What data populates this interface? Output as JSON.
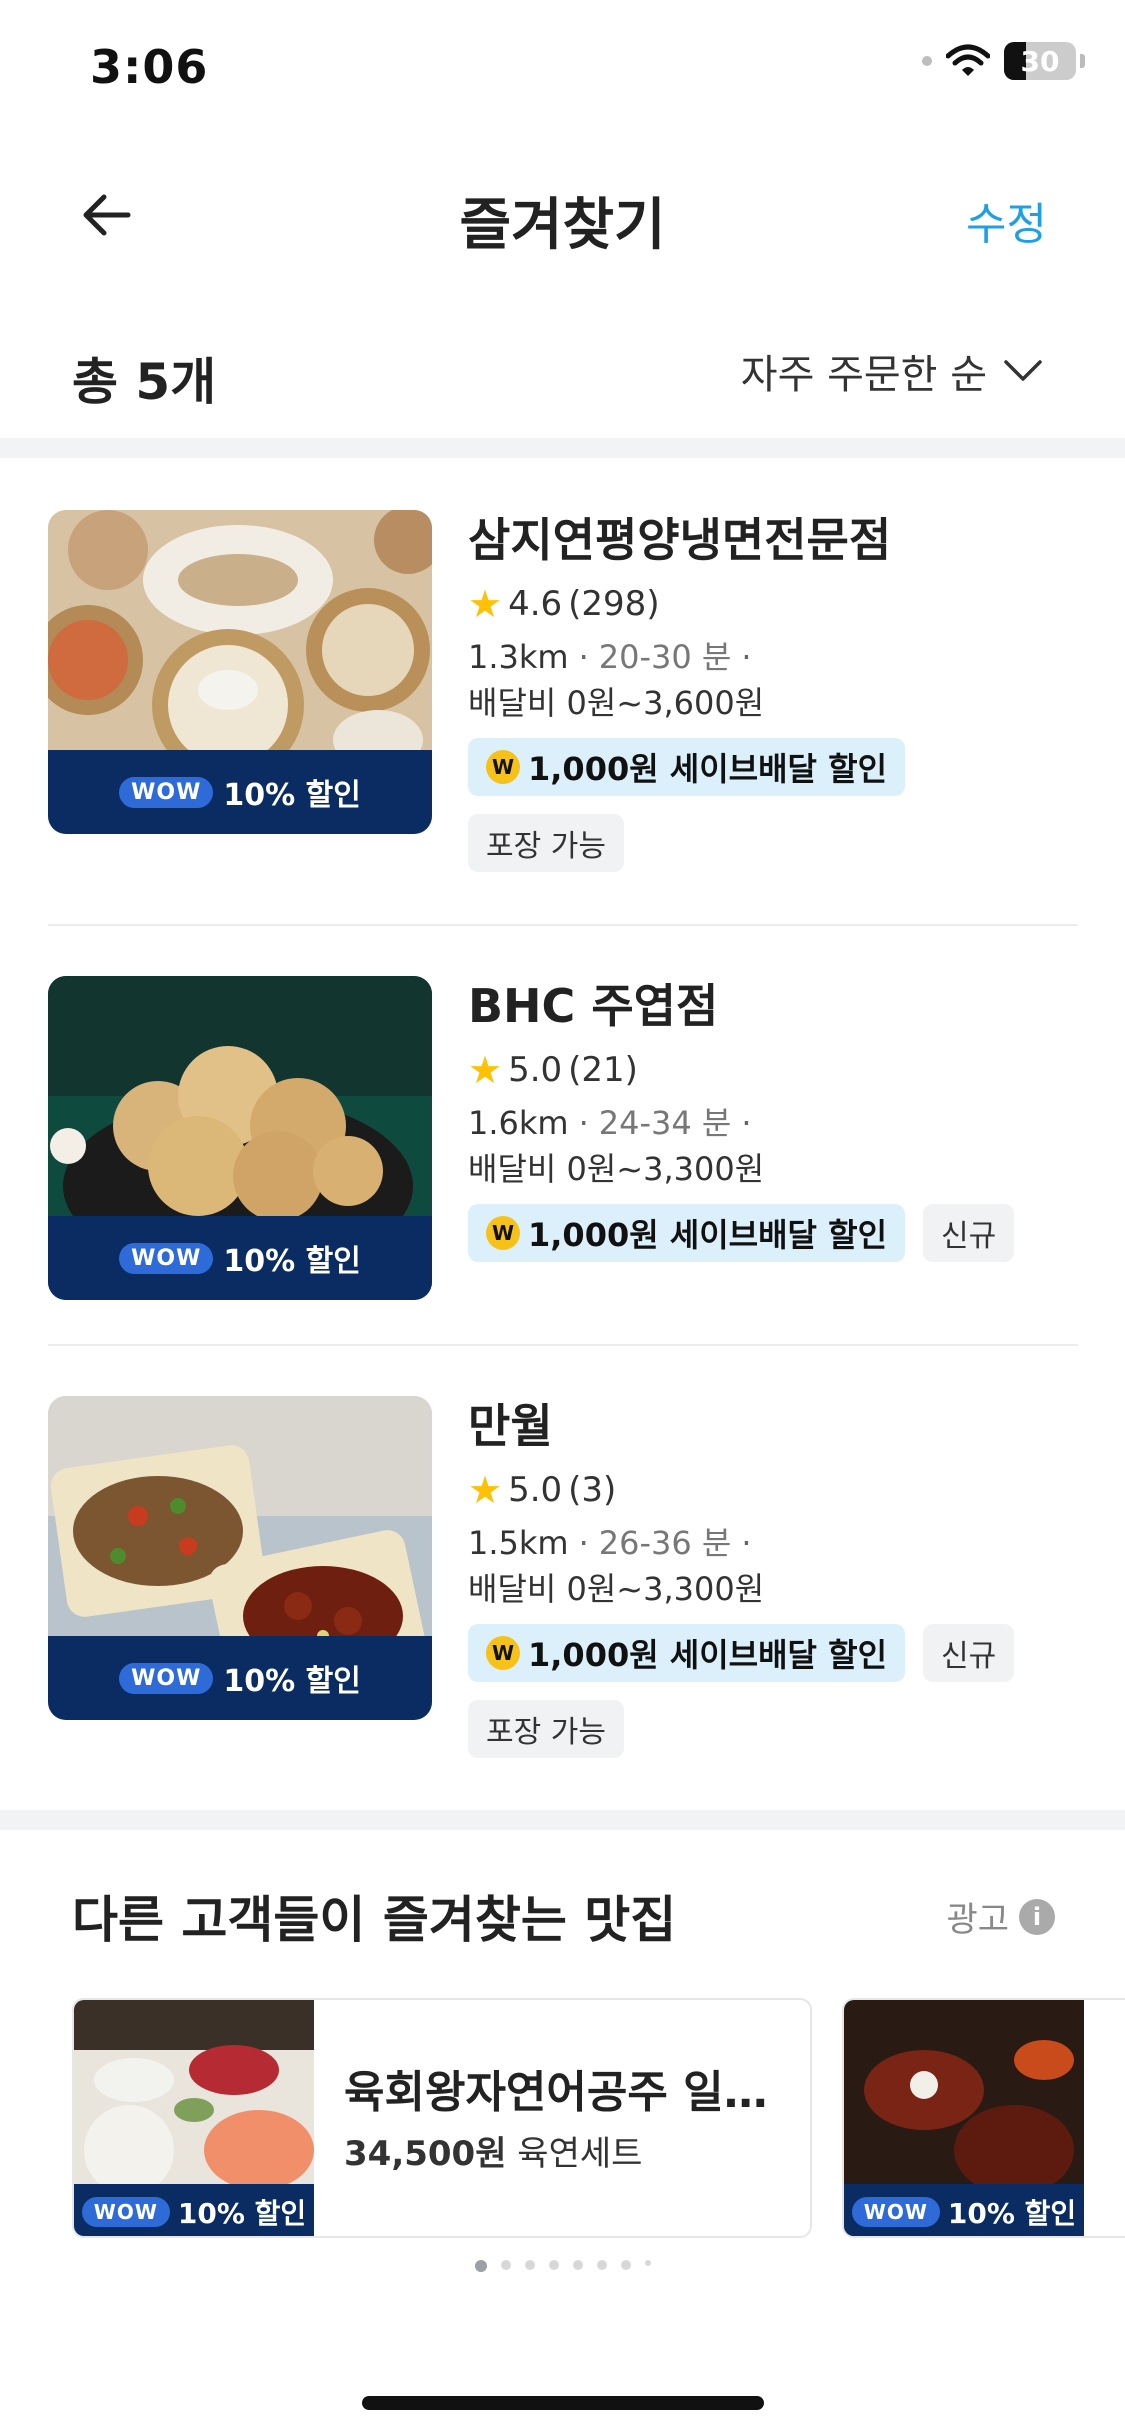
{
  "status": {
    "time": "3:06",
    "battery": "30"
  },
  "header": {
    "title": "즐겨찾기",
    "edit_label": "수정"
  },
  "summary": {
    "count_label": "총 5개",
    "sort_label": "자주 주문한 순"
  },
  "discount": {
    "wow": "WOW",
    "text": "10% 할인"
  },
  "restaurants": [
    {
      "name": "삼지연평양냉면전문점",
      "rating": "4.6",
      "reviews": "(298)",
      "distance": "1.3km",
      "time": "20-30 분",
      "fee": "배달비 0원~3,600원",
      "save": "1,000원 세이브배달 할인",
      "new": "",
      "pack": "포장 가능"
    },
    {
      "name": "BHC 주엽점",
      "rating": "5.0",
      "reviews": "(21)",
      "distance": "1.6km",
      "time": "24-34 분",
      "fee": "배달비 0원~3,300원",
      "save": "1,000원 세이브배달 할인",
      "new": "신규",
      "pack": ""
    },
    {
      "name": "만월",
      "rating": "5.0",
      "reviews": "(3)",
      "distance": "1.5km",
      "time": "26-36 분",
      "fee": "배달비 0원~3,300원",
      "save": "1,000원 세이브배달 할인",
      "new": "신규",
      "pack": "포장 가능"
    }
  ],
  "recommend": {
    "title": "다른 고객들이 즐겨찾는 맛집",
    "ad_label": "광고",
    "cards": [
      {
        "name": "육회왕자연어공주 일…",
        "price": "34,500원",
        "menu": "육연세트"
      }
    ]
  },
  "colors": {
    "accent": "#1e9fe6",
    "discount_bar": "#0b2c63",
    "wow_badge": "#2f6bd8",
    "save_tag": "#dcf0fb",
    "star": "#ffc107"
  }
}
